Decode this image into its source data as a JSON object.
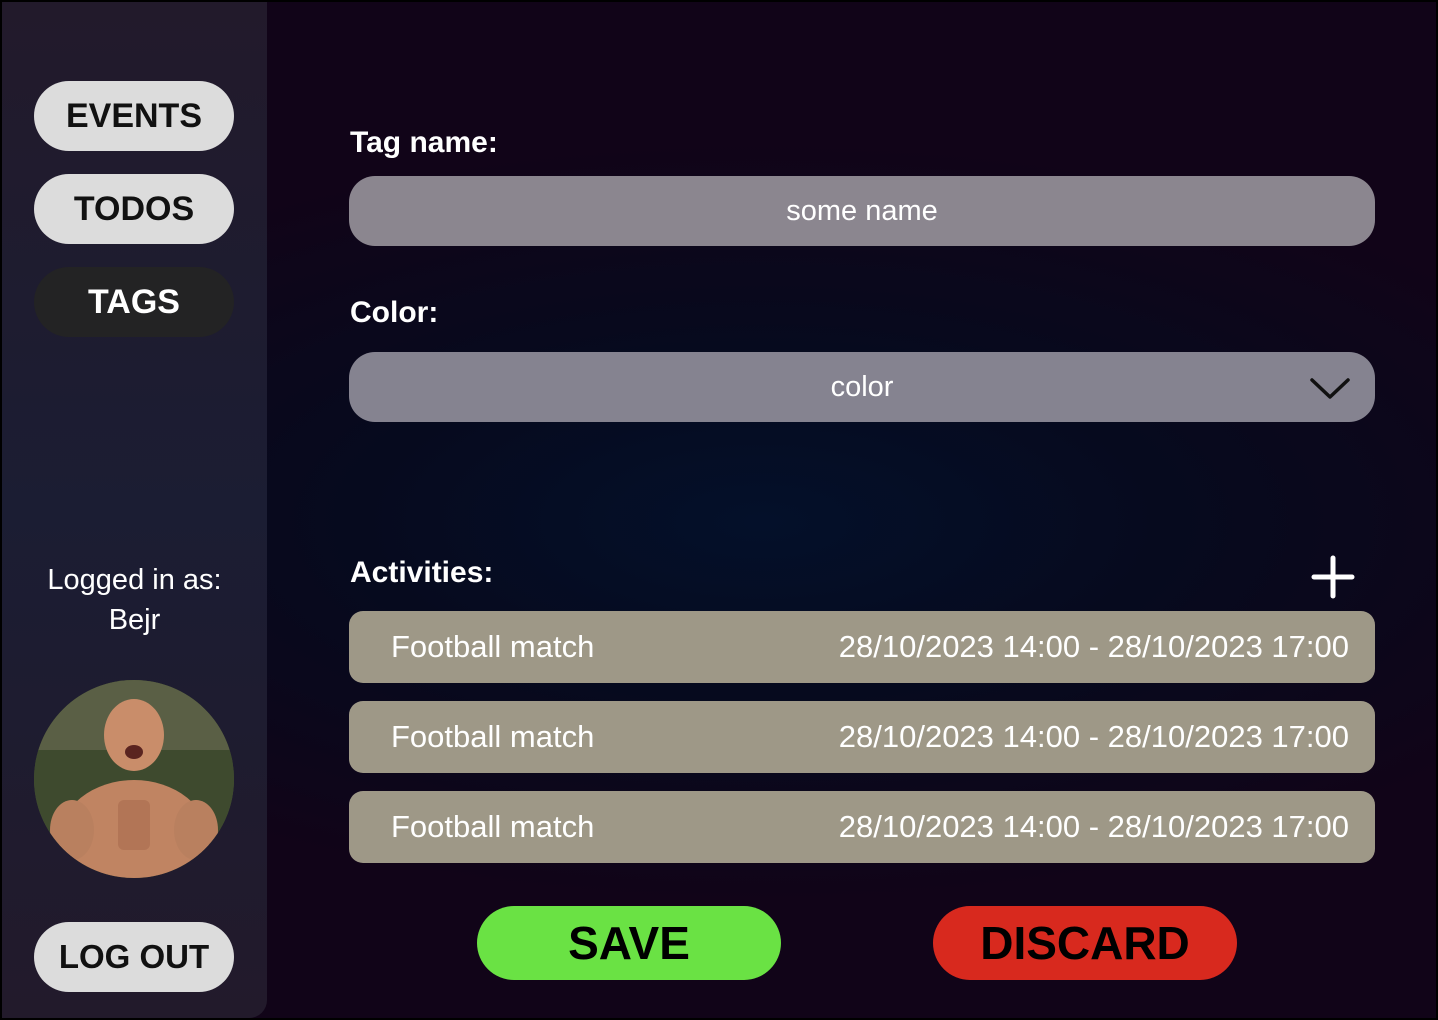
{
  "sidebar": {
    "nav": [
      {
        "label": "EVENTS"
      },
      {
        "label": "TODOS"
      },
      {
        "label": "TAGS"
      }
    ],
    "logged_in_label": "Logged in as:",
    "username": "Bejr",
    "logout_label": "LOG OUT"
  },
  "form": {
    "tag_name_label": "Tag name:",
    "tag_name_placeholder": "some name",
    "color_label": "Color:",
    "color_value": "color",
    "activities_label": "Activities:",
    "activities": [
      {
        "name": "Football match",
        "time": "28/10/2023 14:00 - 28/10/2023 17:00"
      },
      {
        "name": "Football match",
        "time": "28/10/2023 14:00 - 28/10/2023 17:00"
      },
      {
        "name": "Football match",
        "time": "28/10/2023 14:00 - 28/10/2023 17:00"
      }
    ],
    "save_label": "SAVE",
    "discard_label": "DISCARD"
  },
  "colors": {
    "save": "#6ae244",
    "discard": "#d8291e",
    "active_nav": "#232324",
    "activity_row": "#9e9887"
  },
  "icons": {
    "add": "plus-icon",
    "dropdown": "chevron-down-icon",
    "avatar": "user-avatar"
  }
}
